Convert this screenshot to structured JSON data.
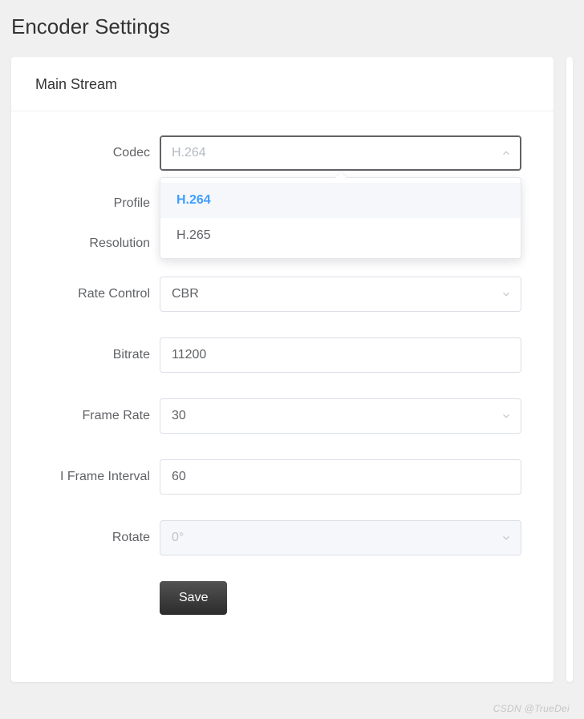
{
  "page": {
    "title": "Encoder Settings"
  },
  "panel": {
    "title": "Main Stream"
  },
  "form": {
    "codec": {
      "label": "Codec",
      "value": "H.264",
      "options": [
        "H.264",
        "H.265"
      ],
      "selected_index": 0
    },
    "profile": {
      "label": "Profile"
    },
    "resolution": {
      "label": "Resolution"
    },
    "rate_control": {
      "label": "Rate Control",
      "value": "CBR"
    },
    "bitrate": {
      "label": "Bitrate",
      "value": "11200"
    },
    "frame_rate": {
      "label": "Frame Rate",
      "value": "30"
    },
    "i_frame_interval": {
      "label": "I Frame Interval",
      "value": "60"
    },
    "rotate": {
      "label": "Rotate",
      "value": "0°",
      "disabled": true
    },
    "save": {
      "label": "Save"
    }
  },
  "watermark": "CSDN @TrueDei"
}
